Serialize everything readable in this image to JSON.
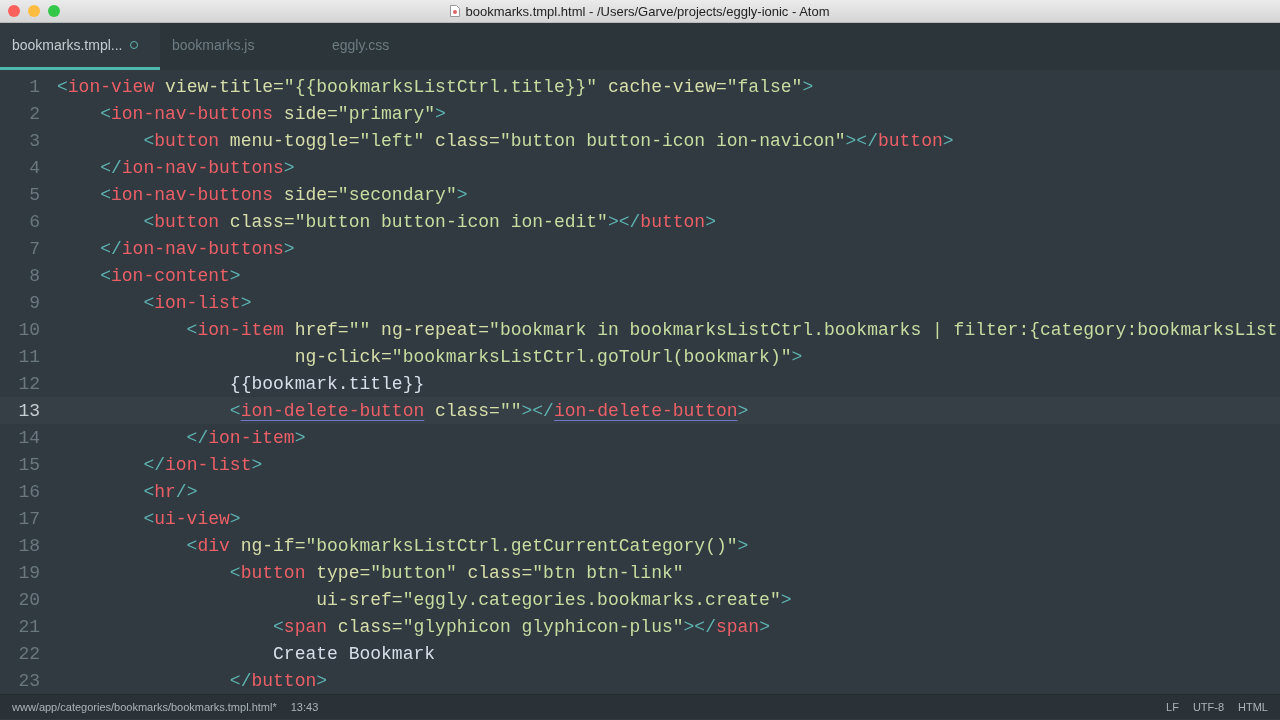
{
  "window": {
    "title": "bookmarks.tmpl.html - /Users/Garve/projects/eggly-ionic - Atom"
  },
  "tabs": [
    {
      "label": "bookmarks.tmpl...",
      "selected": true,
      "modified": true
    },
    {
      "label": "bookmarks.js",
      "selected": false,
      "modified": false
    },
    {
      "label": "eggly.css",
      "selected": false,
      "modified": false
    }
  ],
  "editor": {
    "lines": [
      {
        "number": "1",
        "current": false,
        "tokens": [
          {
            "kind": "p",
            "text": "<"
          },
          {
            "kind": "tag",
            "text": "ion-view"
          },
          {
            "kind": "attr",
            "text": " view-title="
          },
          {
            "kind": "str",
            "text": "\"{{bookmarksListCtrl.title}}\""
          },
          {
            "kind": "attr",
            "text": " cache-view="
          },
          {
            "kind": "str",
            "text": "\"false\""
          },
          {
            "kind": "p",
            "text": ">"
          }
        ]
      },
      {
        "number": "2",
        "current": false,
        "tokens": [
          {
            "kind": "p",
            "text": "    <"
          },
          {
            "kind": "tag",
            "text": "ion-nav-buttons"
          },
          {
            "kind": "attr",
            "text": " side="
          },
          {
            "kind": "str",
            "text": "\"primary\""
          },
          {
            "kind": "p",
            "text": ">"
          }
        ]
      },
      {
        "number": "3",
        "current": false,
        "tokens": [
          {
            "kind": "p",
            "text": "        <"
          },
          {
            "kind": "tag",
            "text": "button"
          },
          {
            "kind": "attr",
            "text": " menu-toggle="
          },
          {
            "kind": "str",
            "text": "\"left\""
          },
          {
            "kind": "attr",
            "text": " class="
          },
          {
            "kind": "str",
            "text": "\"button button-icon ion-navicon\""
          },
          {
            "kind": "p",
            "text": "></"
          },
          {
            "kind": "tag",
            "text": "button"
          },
          {
            "kind": "p",
            "text": ">"
          }
        ]
      },
      {
        "number": "4",
        "current": false,
        "tokens": [
          {
            "kind": "p",
            "text": "    </"
          },
          {
            "kind": "tag",
            "text": "ion-nav-buttons"
          },
          {
            "kind": "p",
            "text": ">"
          }
        ]
      },
      {
        "number": "5",
        "current": false,
        "tokens": [
          {
            "kind": "p",
            "text": "    <"
          },
          {
            "kind": "tag",
            "text": "ion-nav-buttons"
          },
          {
            "kind": "attr",
            "text": " side="
          },
          {
            "kind": "str",
            "text": "\"secondary\""
          },
          {
            "kind": "p",
            "text": ">"
          }
        ]
      },
      {
        "number": "6",
        "current": false,
        "tokens": [
          {
            "kind": "p",
            "text": "        <"
          },
          {
            "kind": "tag",
            "text": "button"
          },
          {
            "kind": "attr",
            "text": " class="
          },
          {
            "kind": "str",
            "text": "\"button button-icon ion-edit\""
          },
          {
            "kind": "p",
            "text": "></"
          },
          {
            "kind": "tag",
            "text": "button"
          },
          {
            "kind": "p",
            "text": ">"
          }
        ]
      },
      {
        "number": "7",
        "current": false,
        "tokens": [
          {
            "kind": "p",
            "text": "    </"
          },
          {
            "kind": "tag",
            "text": "ion-nav-buttons"
          },
          {
            "kind": "p",
            "text": ">"
          }
        ]
      },
      {
        "number": "8",
        "current": false,
        "tokens": [
          {
            "kind": "p",
            "text": "    <"
          },
          {
            "kind": "tag",
            "text": "ion-content"
          },
          {
            "kind": "p",
            "text": ">"
          }
        ]
      },
      {
        "number": "9",
        "current": false,
        "tokens": [
          {
            "kind": "p",
            "text": "        <"
          },
          {
            "kind": "tag",
            "text": "ion-list"
          },
          {
            "kind": "p",
            "text": ">"
          }
        ]
      },
      {
        "number": "10",
        "current": false,
        "tokens": [
          {
            "kind": "p",
            "text": "            <"
          },
          {
            "kind": "tag",
            "text": "ion-item"
          },
          {
            "kind": "attr",
            "text": " href="
          },
          {
            "kind": "str",
            "text": "\"\""
          },
          {
            "kind": "attr",
            "text": " ng-repeat="
          },
          {
            "kind": "str",
            "text": "\"bookmark in bookmarksListCtrl.bookmarks | filter:{category:bookmarksList"
          }
        ]
      },
      {
        "number": "11",
        "current": false,
        "tokens": [
          {
            "kind": "attr",
            "text": "                      ng-click="
          },
          {
            "kind": "str",
            "text": "\"bookmarksListCtrl.goToUrl(bookmark)\""
          },
          {
            "kind": "p",
            "text": ">"
          }
        ]
      },
      {
        "number": "12",
        "current": false,
        "tokens": [
          {
            "kind": "text",
            "text": "                {{bookmark.title}}"
          }
        ]
      },
      {
        "number": "13",
        "current": true,
        "tokens": [
          {
            "kind": "p",
            "text": "                <"
          },
          {
            "kind": "tag",
            "text": "ion-delete-button",
            "matched": true
          },
          {
            "kind": "attr",
            "text": " class="
          },
          {
            "kind": "str",
            "text": "\"\""
          },
          {
            "kind": "p",
            "text": "></"
          },
          {
            "kind": "tag",
            "text": "ion-delete-button",
            "matched": true
          },
          {
            "kind": "p",
            "text": ">"
          }
        ]
      },
      {
        "number": "14",
        "current": false,
        "tokens": [
          {
            "kind": "p",
            "text": "            </"
          },
          {
            "kind": "tag",
            "text": "ion-item"
          },
          {
            "kind": "p",
            "text": ">"
          }
        ]
      },
      {
        "number": "15",
        "current": false,
        "tokens": [
          {
            "kind": "p",
            "text": "        </"
          },
          {
            "kind": "tag",
            "text": "ion-list"
          },
          {
            "kind": "p",
            "text": ">"
          }
        ]
      },
      {
        "number": "16",
        "current": false,
        "tokens": [
          {
            "kind": "p",
            "text": "        <"
          },
          {
            "kind": "tag",
            "text": "hr"
          },
          {
            "kind": "p",
            "text": "/>"
          }
        ]
      },
      {
        "number": "17",
        "current": false,
        "tokens": [
          {
            "kind": "p",
            "text": "        <"
          },
          {
            "kind": "tag",
            "text": "ui-view"
          },
          {
            "kind": "p",
            "text": ">"
          }
        ]
      },
      {
        "number": "18",
        "current": false,
        "tokens": [
          {
            "kind": "p",
            "text": "            <"
          },
          {
            "kind": "tag",
            "text": "div"
          },
          {
            "kind": "attr",
            "text": " ng-if="
          },
          {
            "kind": "str",
            "text": "\"bookmarksListCtrl.getCurrentCategory()\""
          },
          {
            "kind": "p",
            "text": ">"
          }
        ]
      },
      {
        "number": "19",
        "current": false,
        "tokens": [
          {
            "kind": "p",
            "text": "                <"
          },
          {
            "kind": "tag",
            "text": "button"
          },
          {
            "kind": "attr",
            "text": " type="
          },
          {
            "kind": "str",
            "text": "\"button\""
          },
          {
            "kind": "attr",
            "text": " class="
          },
          {
            "kind": "str",
            "text": "\"btn btn-link\""
          }
        ]
      },
      {
        "number": "20",
        "current": false,
        "tokens": [
          {
            "kind": "attr",
            "text": "                        ui-sref="
          },
          {
            "kind": "str",
            "text": "\"eggly.categories.bookmarks.create\""
          },
          {
            "kind": "p",
            "text": ">"
          }
        ]
      },
      {
        "number": "21",
        "current": false,
        "tokens": [
          {
            "kind": "p",
            "text": "                    <"
          },
          {
            "kind": "tag",
            "text": "span"
          },
          {
            "kind": "attr",
            "text": " class="
          },
          {
            "kind": "str",
            "text": "\"glyphicon glyphicon-plus\""
          },
          {
            "kind": "p",
            "text": "></"
          },
          {
            "kind": "tag",
            "text": "span"
          },
          {
            "kind": "p",
            "text": ">"
          }
        ]
      },
      {
        "number": "22",
        "current": false,
        "tokens": [
          {
            "kind": "text",
            "text": "                    Create Bookmark"
          }
        ]
      },
      {
        "number": "23",
        "current": false,
        "tokens": [
          {
            "kind": "p",
            "text": "                </"
          },
          {
            "kind": "tag",
            "text": "button"
          },
          {
            "kind": "p",
            "text": ">"
          }
        ]
      }
    ]
  },
  "status_bar": {
    "path": "www/app/categories/bookmarks/bookmarks.tmpl.html*",
    "cursor": "13:43",
    "line_ending": "LF",
    "encoding": "UTF-8",
    "grammar": "HTML"
  }
}
